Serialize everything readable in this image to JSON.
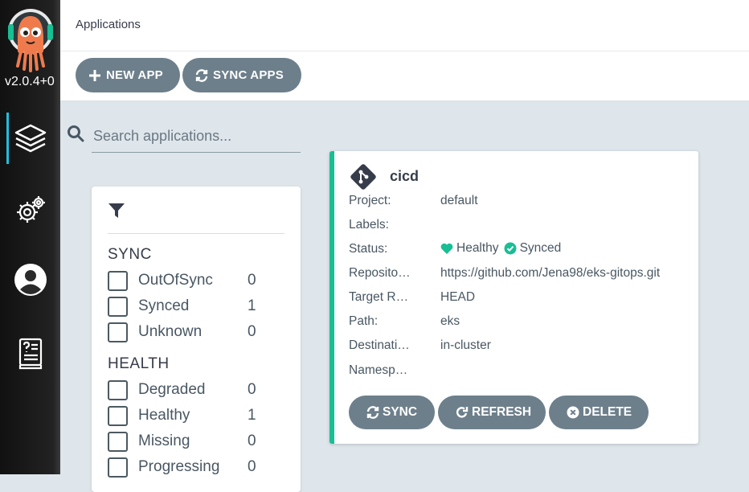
{
  "sidebar": {
    "version": "v2.0.4+0",
    "nav": [
      {
        "icon": "layers-icon"
      },
      {
        "icon": "settings-gears-icon"
      },
      {
        "icon": "user-icon"
      },
      {
        "icon": "docs-icon"
      }
    ]
  },
  "header": {
    "title": "Applications"
  },
  "toolbar": {
    "new_app": "NEW APP",
    "sync_apps": "SYNC APPS"
  },
  "search": {
    "placeholder": "Search applications..."
  },
  "filters": {
    "sync_heading": "SYNC",
    "sync": [
      {
        "label": "OutOfSync",
        "count": "0"
      },
      {
        "label": "Synced",
        "count": "1"
      },
      {
        "label": "Unknown",
        "count": "0"
      }
    ],
    "health_heading": "HEALTH",
    "health": [
      {
        "label": "Degraded",
        "count": "0"
      },
      {
        "label": "Healthy",
        "count": "1"
      },
      {
        "label": "Missing",
        "count": "0"
      },
      {
        "label": "Progressing",
        "count": "0"
      }
    ]
  },
  "app": {
    "name": "cicd",
    "fields": {
      "project_key": "Project:",
      "project_val": "default",
      "labels_key": "Labels:",
      "labels_val": "",
      "status_key": "Status:",
      "health_val": "Healthy",
      "sync_val": "Synced",
      "repo_key": "Reposito…",
      "repo_val": "https://github.com/Jena98/eks-gitops.git",
      "target_key": "Target R…",
      "target_val": "HEAD",
      "path_key": "Path:",
      "path_val": "eks",
      "dest_key": "Destinati…",
      "dest_val": "in-cluster",
      "ns_key": "Namesp…",
      "ns_val": ""
    },
    "actions": {
      "sync": "SYNC",
      "refresh": "REFRESH",
      "delete": "DELETE"
    }
  },
  "colors": {
    "sidebar_bg": "#111111",
    "accent": "#1ebfde",
    "healthy": "#18be94",
    "button": "#6d7f8b"
  }
}
